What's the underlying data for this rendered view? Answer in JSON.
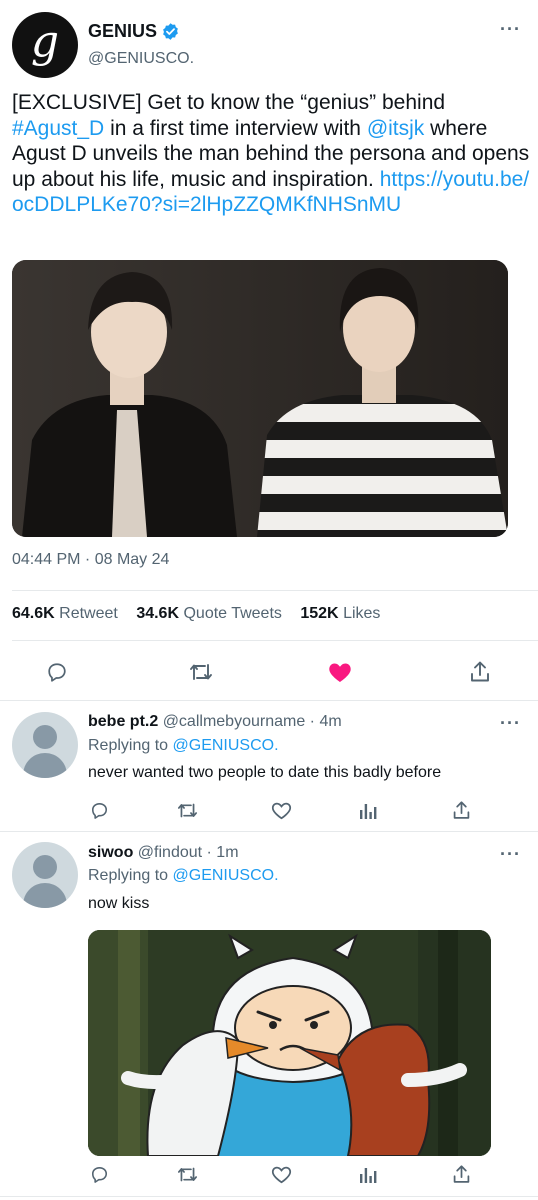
{
  "main_tweet": {
    "display_name": "GENIUS",
    "handle": "@GENIUSCO.",
    "avatar_letter": "g",
    "text_plain_1": "[EXCLUSIVE] Get to know the “genius” behind ",
    "hashtag": "#Agust_D",
    "text_plain_2": " in a first time interview with ",
    "mention": "@itsjk",
    "text_plain_3": " where Agust D unveils the man behind the persona and opens up about his life, music and inspiration. ",
    "link": "https://youtu.be/ocDDLPLKe70?si=2lHpZZQMKfNHSnMU",
    "timestamp": "04:44 PM · 08 May 24",
    "stats": {
      "retweets_count": "64.6K",
      "retweets_label": "Retweet",
      "quotes_count": "34.6K",
      "quotes_label": "Quote Tweets",
      "likes_count": "152K",
      "likes_label": "Likes"
    },
    "liked": true
  },
  "replies": [
    {
      "display_name": "bebe pt.2",
      "handle": "@callmebyourname",
      "time": "· 4m",
      "replying_prefix": "Replying to",
      "replying_to": "@GENIUSCO.",
      "text": "never wanted two people to date this badly before"
    },
    {
      "display_name": "siwoo",
      "handle": "@findout",
      "time": "· 1m",
      "replying_prefix": "Replying to",
      "replying_to": "@GENIUSCO.",
      "text": "now kiss"
    }
  ],
  "colors": {
    "accent": "#1d9bf0",
    "like": "#f91880",
    "secondary_text": "#536471"
  },
  "icons": [
    "verified-badge-icon",
    "more-icon",
    "reply-icon",
    "retweet-icon",
    "like-icon",
    "share-icon",
    "analytics-icon"
  ]
}
